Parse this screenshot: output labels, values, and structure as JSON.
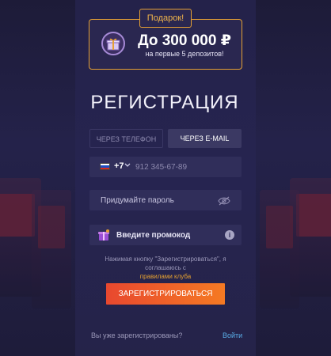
{
  "bonus": {
    "tag": "Подарок!",
    "amount": "До 300 000 ₽",
    "subtitle": "на первые 5 депозитов!"
  },
  "form": {
    "title": "РЕГИСТРАЦИЯ",
    "tabs": [
      {
        "label": "Через телефон",
        "active": false
      },
      {
        "label": "Через e-mail",
        "active": true
      }
    ],
    "phone": {
      "country_code": "+7",
      "placeholder": "912 345-67-89",
      "value": ""
    },
    "password": {
      "placeholder": "Придумайте пароль",
      "value": ""
    },
    "promo": {
      "placeholder": "Введите промокод",
      "value": "",
      "info": "i"
    },
    "terms_text": "Нажимая кнопку \"Зарегистрироваться\", я соглашаюсь с",
    "terms_link": "правилами клуба",
    "submit_label": "Зарегистрироваться"
  },
  "footer": {
    "already_text": "Вы уже зарегистрированы?",
    "login_label": "Войти"
  },
  "colors": {
    "accent": "#e7a230",
    "button_start": "#e8482f",
    "button_end": "#f57a23",
    "link": "#5aaee8",
    "background": "#211f3f"
  },
  "icons": [
    "gift-icon",
    "russia-flag-icon",
    "chevron-down-icon",
    "eye-off-icon",
    "promo-gift-icon",
    "info-icon"
  ]
}
